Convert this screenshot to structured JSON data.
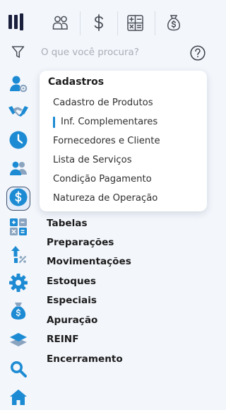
{
  "search": {
    "placeholder": "O que você procura?"
  },
  "submenu": {
    "title": "Cadastros",
    "items": [
      {
        "label": "Cadastro de Produtos",
        "active": false
      },
      {
        "label": "Inf. Complementares",
        "active": true
      },
      {
        "label": "Fornecedores e Cliente",
        "active": false
      },
      {
        "label": "Lista de Serviços",
        "active": false
      },
      {
        "label": "Condição Pagamento",
        "active": false
      },
      {
        "label": "Natureza de Operação",
        "active": false
      }
    ]
  },
  "menu": {
    "items": [
      "Tabelas",
      "Preparações",
      "Movimentações",
      "Estoques",
      "Especiais",
      "Apuração",
      "REINF",
      "Encerramento"
    ]
  },
  "top_tabs": [
    "users-icon",
    "dollar-icon",
    "calculator-icon",
    "money-bag-icon"
  ],
  "sidebar_icons": [
    "user-settings-icon",
    "handshake-icon",
    "clock-icon",
    "users-icon",
    "dollar-circle-icon",
    "calculator-icon",
    "growth-arrow-icon",
    "gear-icon",
    "money-bag-icon",
    "layers-icon",
    "search-icon",
    "home-icon"
  ],
  "colors": {
    "accent": "#1d8bd3",
    "dark_blue": "#1a2340",
    "background": "#f3f6fb"
  }
}
